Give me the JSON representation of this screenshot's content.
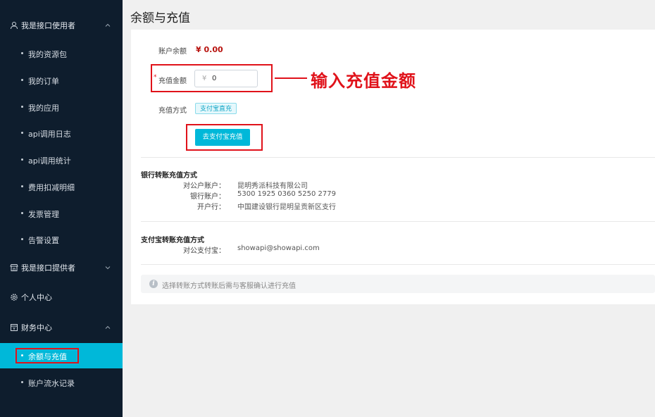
{
  "sidebar": {
    "groups": [
      {
        "label": "我是接口使用者",
        "icon": "user-icon",
        "expanded": true
      },
      {
        "label": "我是接口提供者",
        "icon": "store-icon",
        "expanded": false
      },
      {
        "label": "个人中心",
        "icon": "gear-icon"
      },
      {
        "label": "财务中心",
        "icon": "wallet-icon",
        "expanded": true
      }
    ],
    "user_items": [
      "我的资源包",
      "我的订单",
      "我的应用",
      "api调用日志",
      "api调用统计",
      "费用扣减明细",
      "发票管理",
      "告警设置"
    ],
    "finance_items": [
      "余额与充值",
      "账户流水记录"
    ],
    "active_item": "余额与充值"
  },
  "page": {
    "title": "余额与充值"
  },
  "form": {
    "balance_label": "账户余额",
    "balance_value": "¥ 0.00",
    "required_mark": "*",
    "amount_label": "充值金额",
    "currency_symbol": "¥",
    "amount_value": "0",
    "method_label": "充值方式",
    "method_tag": "支付宝直充",
    "pay_button": "去支付宝充值"
  },
  "annotation": {
    "text": "输入充值金额"
  },
  "bank": {
    "title": "银行转账充值方式",
    "rows": [
      {
        "k": "对公户账户：",
        "v": "昆明秀派科技有限公司"
      },
      {
        "k": "银行账户：",
        "v": "5300 1925 0360 5250 2779"
      },
      {
        "k": "开户行：",
        "v": "中国建设银行昆明呈贡新区支行"
      }
    ]
  },
  "alipay": {
    "title": "支付宝转账充值方式",
    "rows": [
      {
        "k": "对公支付宝：",
        "v": "showapi@showapi.com"
      }
    ]
  },
  "notice": {
    "text": "选择转账方式转账后需与客服确认进行充值"
  },
  "colors": {
    "sidebar_bg": "#0e1d2d",
    "accent": "#00b8d9",
    "annotation_red": "#e0121a",
    "balance_red": "#b8130f"
  }
}
